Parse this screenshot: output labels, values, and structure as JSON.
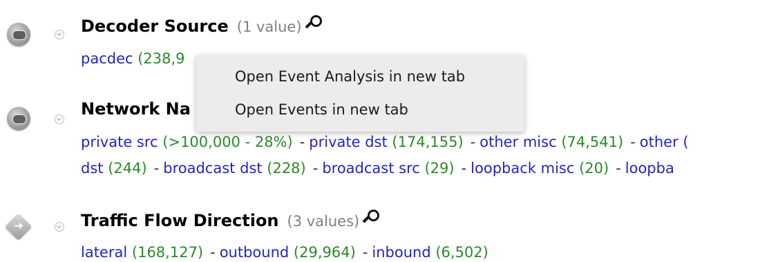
{
  "sections": [
    {
      "title": "Decoder Source",
      "count": "(1 value)",
      "icon": "tag-pill-icon",
      "values_lines": [
        [
          {
            "name": "pacdec",
            "count": "(238,9"
          }
        ]
      ]
    },
    {
      "title": "Network Na",
      "icon": "tag-pill-icon",
      "values_lines": [
        [
          {
            "name": "private src",
            "count": "(>100,000 - 28%)"
          },
          {
            "name": "private dst",
            "count": "(174,155)"
          },
          {
            "name": "other misc",
            "count": "(74,541)"
          },
          {
            "name": "other (",
            "count": ""
          }
        ],
        [
          {
            "name": "dst",
            "count": "(244)"
          },
          {
            "name": "broadcast dst",
            "count": "(228)"
          },
          {
            "name": "broadcast src",
            "count": "(29)"
          },
          {
            "name": "loopback misc",
            "count": "(20)"
          },
          {
            "name": "loopba",
            "count": ""
          }
        ]
      ]
    },
    {
      "title": "Traffic Flow Direction",
      "count": "(3 values)",
      "icon": "direction-arrow-icon",
      "values_lines": [
        [
          {
            "name": "lateral",
            "count": "(168,127)"
          },
          {
            "name": "outbound",
            "count": "(29,964)"
          },
          {
            "name": "inbound",
            "count": "(6,502)"
          }
        ]
      ]
    }
  ],
  "separator": "-",
  "context_menu": {
    "items": [
      "Open Event Analysis in new tab",
      "Open Events in new tab"
    ]
  },
  "colors": {
    "value_link": "#2323c8",
    "value_count": "#2a8a2a",
    "muted_count": "#808080",
    "menu_bg": "#ececec"
  }
}
